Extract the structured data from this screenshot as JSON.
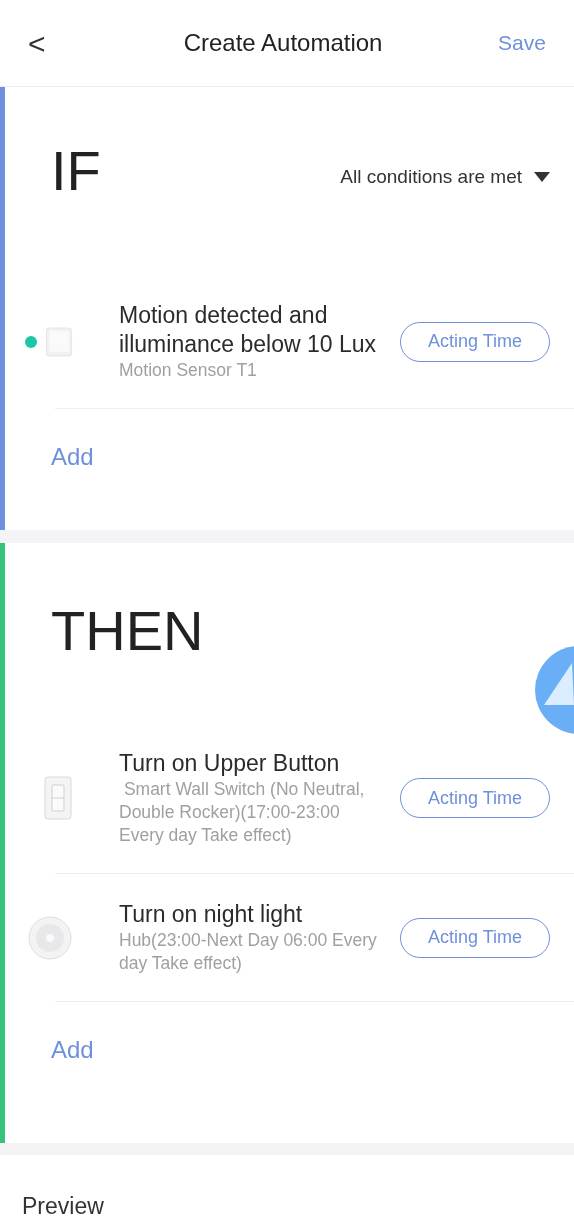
{
  "header": {
    "back": "<",
    "title": "Create Automation",
    "action": "Save"
  },
  "if_section": {
    "heading": "IF",
    "mode": "All conditions are met",
    "items": [
      {
        "kind": "sensor",
        "marked": true,
        "title": "Motion detected and illuminance below 10 Lux",
        "subtitle": "Motion Sensor T1",
        "button": "Acting Time"
      }
    ],
    "add": "Add"
  },
  "then_section": {
    "heading": "THEN",
    "items": [
      {
        "kind": "switch",
        "marked": false,
        "title": "Turn on Upper Button",
        "subtitle": " Smart Wall Switch (No Neutral, Double Rocker)(17:00-23:00 Every day Take effect)",
        "button": "Acting Time"
      },
      {
        "kind": "hub",
        "marked": false,
        "title": "Turn on night light",
        "subtitle": "Hub(23:00-Next Day 06:00 Every day Take effect)",
        "button": "Acting Time"
      }
    ],
    "add": "Add"
  },
  "footer": {
    "label": "Preview"
  }
}
